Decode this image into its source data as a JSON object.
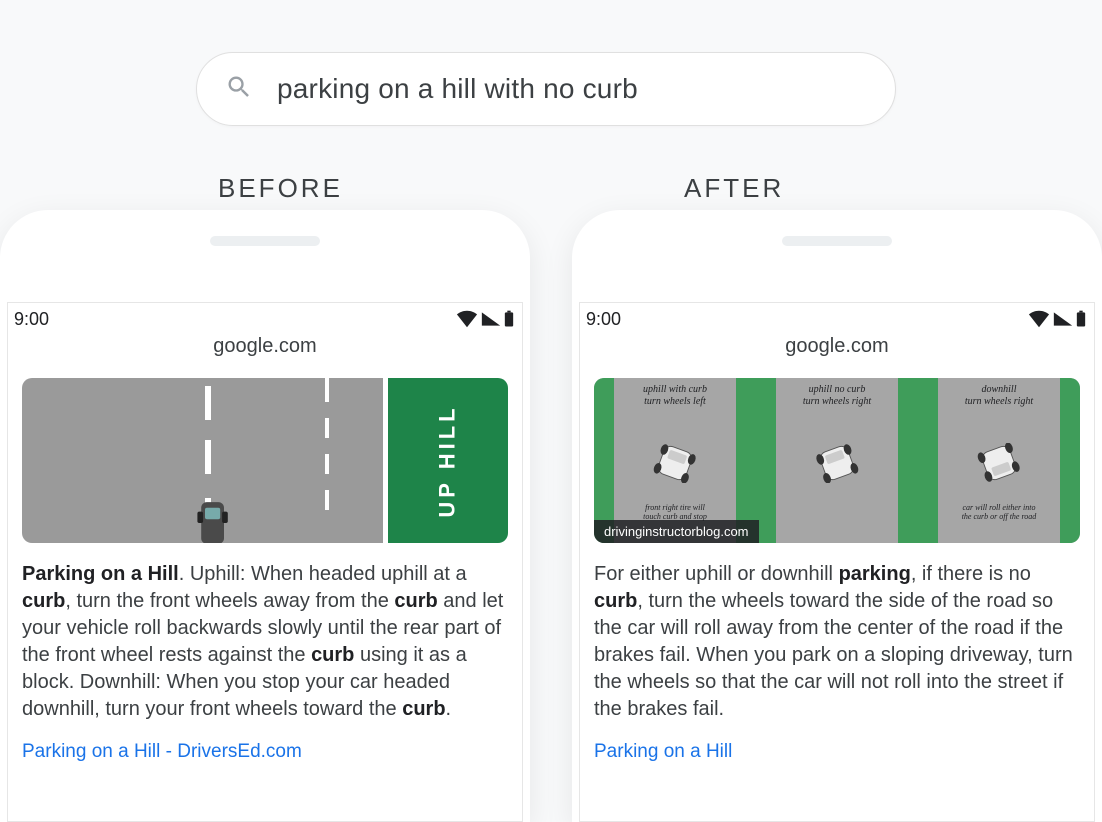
{
  "search": {
    "query": "parking on a hill with no curb"
  },
  "labels": {
    "before": "BEFORE",
    "after": "AFTER"
  },
  "status": {
    "time": "9:00"
  },
  "url": "google.com",
  "before": {
    "image_label": "UP HILL",
    "snippet_html": "<b>Parking on a Hill</b>. Uphill: When headed uphill at a <b>curb</b>, turn the front wheels away from the <b>curb</b> and let your vehicle roll backwards slowly until the rear part of the front wheel rests against the <b>curb</b> using it as a block. Downhill: When you stop your car headed downhill, turn your front wheels toward the <b>curb</b>.",
    "link": "Parking on a Hill - DriversEd.com"
  },
  "after": {
    "source": "drivinginstructorblog.com",
    "panels": [
      {
        "title": "uphill with curb<br>turn wheels left",
        "sub": "front right tire will<br>touch curb and stop"
      },
      {
        "title": "uphill no curb<br>turn wheels right",
        "sub": ""
      },
      {
        "title": "downhill<br>turn wheels right",
        "sub": "car will roll either into<br>the curb or off the road"
      }
    ],
    "snippet_html": "For either uphill or downhill <b>parking</b>, if there is no <b>curb</b>, turn the wheels toward the side of the road so the car will roll away from the center of the road if the brakes fail. When you park on a sloping driveway, turn the wheels so that the car will not roll into the street if the brakes fail.",
    "link": "Parking on a Hill"
  }
}
